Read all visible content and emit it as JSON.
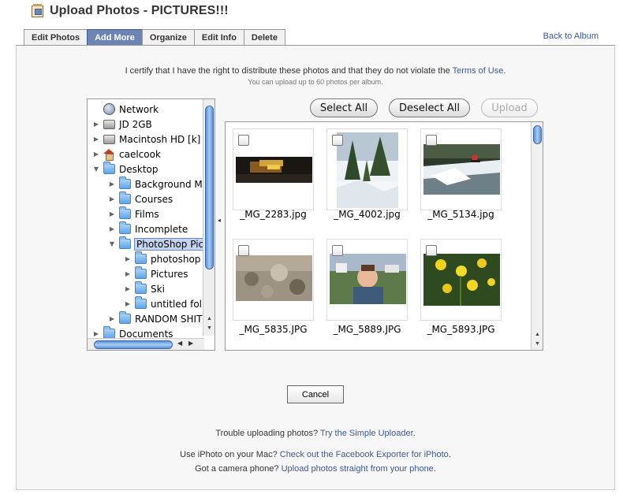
{
  "header": {
    "title": "Upload Photos - PICTURES!!!"
  },
  "tabs": [
    {
      "label": "Edit Photos",
      "active": false
    },
    {
      "label": "Add More",
      "active": true
    },
    {
      "label": "Organize",
      "active": false
    },
    {
      "label": "Edit Info",
      "active": false
    },
    {
      "label": "Delete",
      "active": false
    }
  ],
  "back_link": "Back to Album",
  "certify": {
    "text": "I certify that I have the right to distribute these photos and that they do not violate the",
    "link": "Terms of Use",
    "end": "."
  },
  "limit_text": "You can upload up to 60 photos per album.",
  "tree": {
    "items": [
      {
        "label": "Network",
        "icon": "network-icon",
        "indent": 0,
        "disclosure": ""
      },
      {
        "label": "JD 2GB",
        "icon": "drive-icon",
        "indent": 0,
        "disclosure": "▶"
      },
      {
        "label": "Macintosh HD [k]",
        "icon": "drive-icon",
        "indent": 0,
        "disclosure": "▶"
      },
      {
        "label": "caelcook",
        "icon": "home-icon",
        "indent": 0,
        "disclosure": "▶"
      },
      {
        "label": "Desktop",
        "icon": "folder-icon",
        "indent": 0,
        "disclosure": "▼"
      },
      {
        "label": "Background M",
        "icon": "folder-icon",
        "indent": 1,
        "disclosure": "▶"
      },
      {
        "label": "Courses",
        "icon": "folder-icon",
        "indent": 1,
        "disclosure": "▶"
      },
      {
        "label": "Films",
        "icon": "folder-icon",
        "indent": 1,
        "disclosure": "▶"
      },
      {
        "label": "Incomplete",
        "icon": "folder-icon",
        "indent": 1,
        "disclosure": "▶"
      },
      {
        "label": "PhotoShop Pict",
        "icon": "folder-icon",
        "indent": 1,
        "disclosure": "▼",
        "selected": true
      },
      {
        "label": "photoshop",
        "icon": "folder-icon",
        "indent": 2,
        "disclosure": "▶"
      },
      {
        "label": "Pictures",
        "icon": "folder-icon",
        "indent": 2,
        "disclosure": "▶"
      },
      {
        "label": "Ski",
        "icon": "folder-icon",
        "indent": 2,
        "disclosure": "▶"
      },
      {
        "label": "untitled fol",
        "icon": "folder-icon",
        "indent": 2,
        "disclosure": "▶"
      },
      {
        "label": "RANDOM SHIT",
        "icon": "folder-icon",
        "indent": 1,
        "disclosure": "▶"
      },
      {
        "label": "Documents",
        "icon": "folder-icon",
        "indent": 0,
        "disclosure": "▶"
      }
    ]
  },
  "buttons": {
    "select_all": "Select All",
    "deselect_all": "Deselect All",
    "upload": "Upload",
    "cancel": "Cancel"
  },
  "photos": [
    {
      "name": "_MG_2283.jpg",
      "checked": false
    },
    {
      "name": "_MG_4002.jpg",
      "checked": false
    },
    {
      "name": "_MG_5134.jpg",
      "checked": false
    },
    {
      "name": "_MG_5835.JPG",
      "checked": false
    },
    {
      "name": "_MG_5889.JPG",
      "checked": false
    },
    {
      "name": "_MG_5893.JPG",
      "checked": false
    }
  ],
  "help": {
    "trouble_text": "Trouble uploading photos?",
    "trouble_link": "Try the Simple Uploader",
    "trouble_end": ".",
    "iphoto_text": "Use iPhoto on your Mac?",
    "iphoto_link": "Check out the Facebook Exporter for iPhoto",
    "iphoto_end": ".",
    "phone_text": "Got a camera phone?",
    "phone_link": "Upload photos straight from your phone",
    "phone_end": "."
  },
  "colors": {
    "link": "#3b5998",
    "tab_active": "#6d84b4",
    "scroll_accent": "#5a8fd8"
  }
}
